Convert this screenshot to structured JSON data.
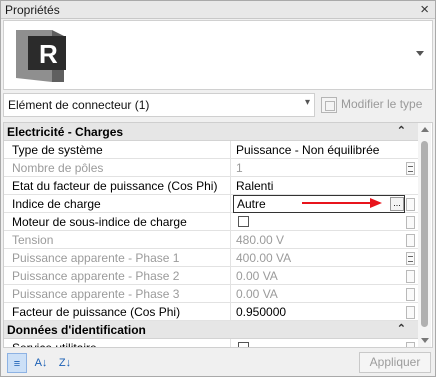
{
  "window": {
    "title": "Propriétés"
  },
  "type_selector": {
    "logo_letter": "R"
  },
  "filter": {
    "selected": "Elément de connecteur (1)",
    "edit_type_label": "Modifier le type"
  },
  "groups": [
    {
      "label": "Electricité - Charges"
    },
    {
      "label": "Données d'identification"
    }
  ],
  "rows": [
    {
      "name": "Type de système",
      "value": "Puissance - Non équilibrée"
    },
    {
      "name": "Nombre de pôles",
      "value": "1"
    },
    {
      "name": "Etat du facteur de puissance (Cos Phi)",
      "value": "Ralenti"
    },
    {
      "name": "Indice de charge",
      "value": "Autre"
    },
    {
      "name": "Moteur de sous-indice de charge",
      "value": ""
    },
    {
      "name": "Tension",
      "value": "480.00 V"
    },
    {
      "name": "Puissance apparente - Phase 1",
      "value": "400.00 VA"
    },
    {
      "name": "Puissance apparente - Phase 2",
      "value": "0.00 VA"
    },
    {
      "name": "Puissance apparente - Phase 3",
      "value": "0.00 VA"
    },
    {
      "name": "Facteur de puissance (Cos Phi)",
      "value": "0.950000"
    },
    {
      "name": "Service utilitaire",
      "value": ""
    }
  ],
  "browse_label": "...",
  "apply_label": "Appliquer",
  "colors": {
    "annotation_arrow": "#e8141c",
    "selected_sort": "#cce0f7"
  },
  "icons": [
    "close-icon",
    "dropdown-arrow-icon",
    "edit-type-icon",
    "collapse-icon",
    "browse-icon",
    "checkbox-icon",
    "sort-category-icon",
    "sort-az-icon",
    "sort-za-icon"
  ]
}
